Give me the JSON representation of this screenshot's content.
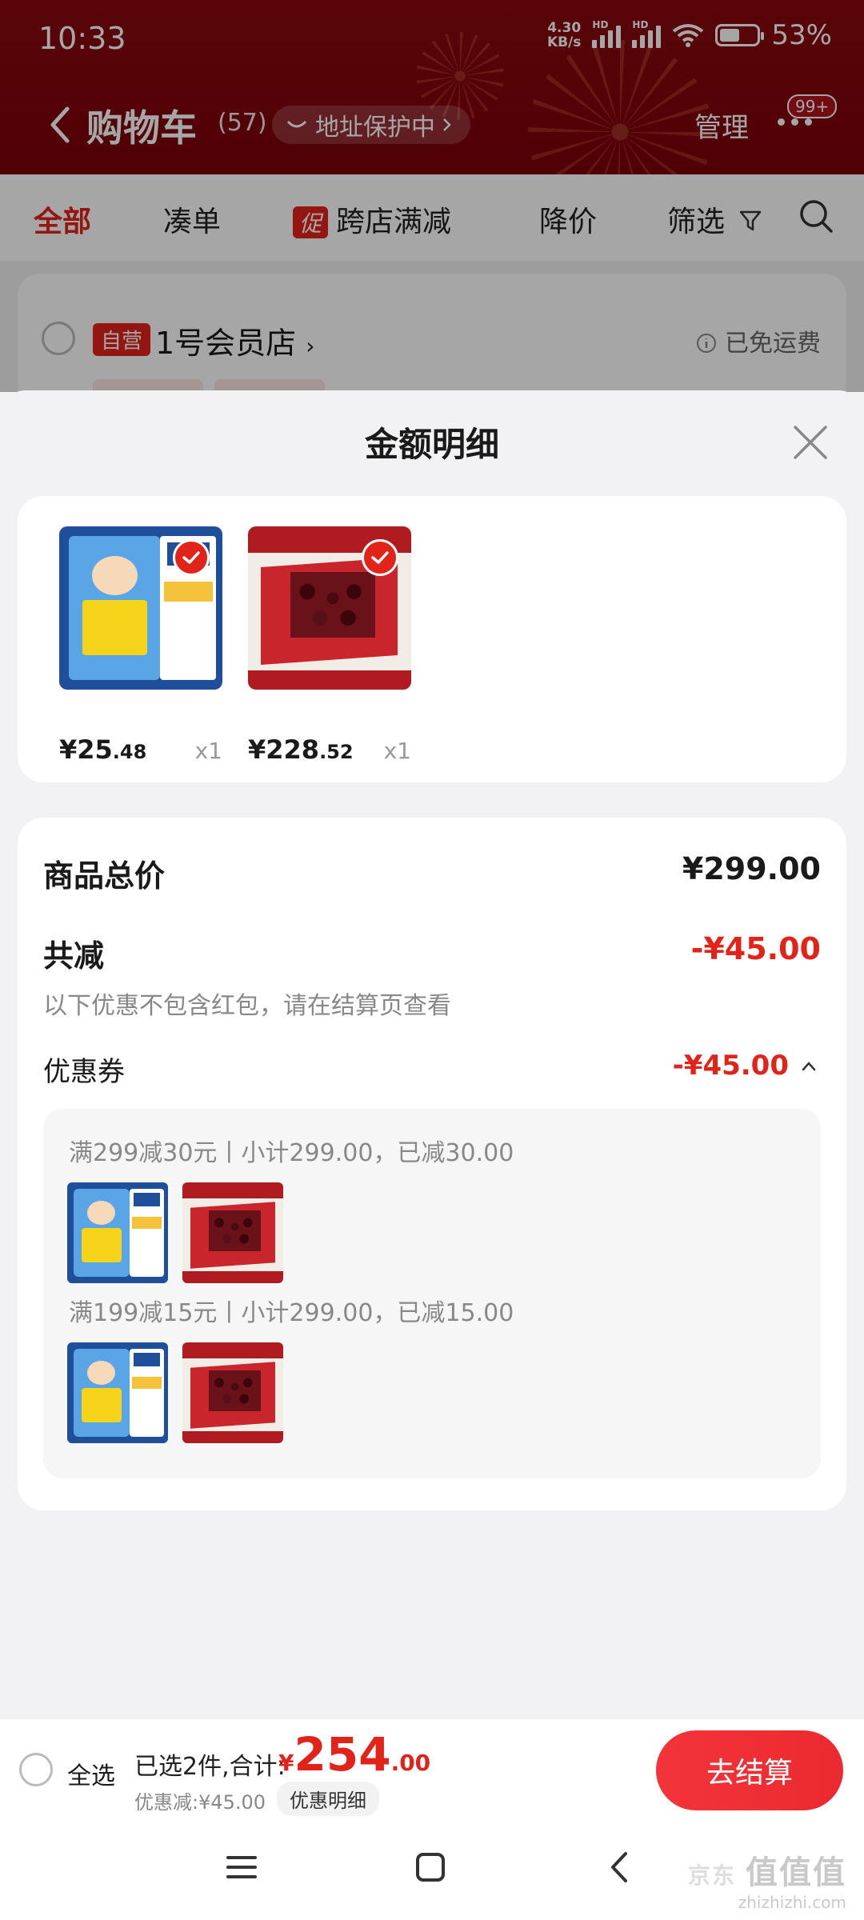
{
  "status_bar": {
    "time": "10:33",
    "net_speed_top": "4.30",
    "net_speed_bottom": "KB/s",
    "hd1": "HD",
    "hd2": "HD",
    "battery": "53%"
  },
  "header": {
    "title": "购物车",
    "count": "(57)",
    "address_protect": "地址保护中",
    "manage": "管理",
    "badge": "99+"
  },
  "filters": [
    {
      "label": "全部"
    },
    {
      "label": "凑单"
    },
    {
      "tag": "促",
      "label": "跨店满减"
    },
    {
      "label": "降价"
    },
    {
      "label": "筛选"
    }
  ],
  "store": {
    "self_tag": "自营",
    "name": "1号会员店",
    "free_shipping": "已免运费"
  },
  "sheet": {
    "title": "金额明细",
    "products": [
      {
        "icon": "kobayashi-cooling-gel",
        "price_int": "¥25",
        "price_dec": ".48",
        "qty": "x1"
      },
      {
        "icon": "cherry-gift-box",
        "price_int": "¥228",
        "price_dec": ".52",
        "qty": "x1"
      }
    ],
    "summary": {
      "total_label": "商品总价",
      "total_value": "¥299.00",
      "reduce_label": "共减",
      "reduce_value": "-¥45.00",
      "note": "以下优惠不包含红包，请在结算页查看",
      "coupon_label": "优惠券",
      "coupon_value": "-¥45.00",
      "coupons": [
        {
          "rule": "满299减30元丨小计299.00，已减30.00"
        },
        {
          "rule": "满199减15元丨小计299.00，已减15.00"
        }
      ]
    }
  },
  "checkout": {
    "select_all": "全选",
    "selected_text": "已选2件,合计:",
    "total_symbol": "¥",
    "total_int": "254",
    "total_dec": ".00",
    "discount": "优惠减:¥45.00",
    "detail_button": "优惠明细",
    "checkout_button": "去结算"
  },
  "watermark": {
    "line1": "值值值",
    "line2": "zhizhizhi.com",
    "brand": "京东"
  },
  "colors": {
    "brand_red": "#e2231a",
    "header_red": "#7a0008"
  }
}
